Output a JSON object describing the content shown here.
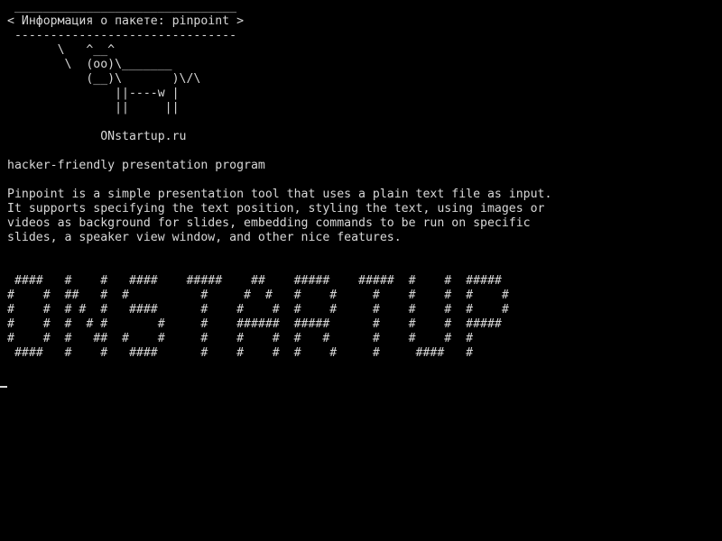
{
  "terminal": {
    "colors": {
      "background": "#000000",
      "foreground": "#d8d8d8"
    },
    "lines": [
      " _______________________________",
      "< Информация о пакете: pinpoint >",
      " -------------------------------",
      "       \\   ^__^",
      "        \\  (oo)\\_______",
      "           (__)\\       )\\/\\",
      "               ||----w |",
      "               ||     ||",
      "",
      "             ONstartup.ru",
      "",
      "hacker-friendly presentation program",
      "",
      "Pinpoint is a simple presentation tool that uses a plain text file as input.",
      "It supports specifying the text position, styling the text, using images or",
      "videos as background for slides, embedding commands to be run on specific",
      "slides, a speaker view window, and other nice features.",
      "",
      "",
      " ####   #    #   ####    #####    ##    #####    #####  #    #  #####",
      "#    #  ##   #  #          #     #  #   #    #     #    #    #  #    #",
      "#    #  # #  #   ####      #    #    #  #    #     #    #    #  #    #",
      "#    #  #  # #       #     #    ######  #####      #    #    #  #####",
      "#    #  #   ##  #    #     #    #    #  #   #      #    #    #  #",
      " ####   #    #   ####      #    #    #  #    #     #     ####   #"
    ]
  }
}
